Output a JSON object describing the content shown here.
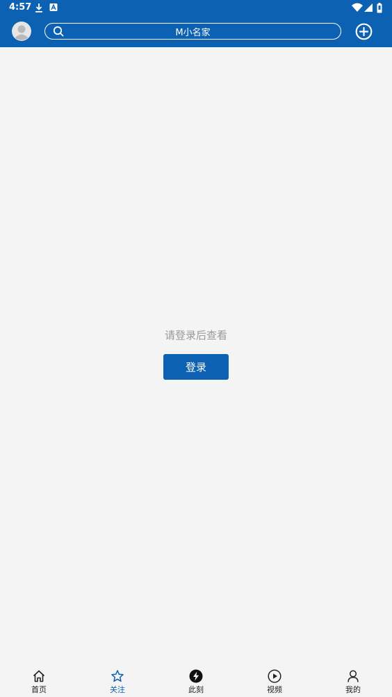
{
  "status_bar": {
    "time": "4:57"
  },
  "header": {
    "search_text": "M小名家"
  },
  "main": {
    "hint": "请登录后查看",
    "login_label": "登录"
  },
  "tabs": [
    {
      "label": "首页",
      "icon": "home-icon",
      "active": false
    },
    {
      "label": "关注",
      "icon": "star-icon",
      "active": true
    },
    {
      "label": "此刻",
      "icon": "lightning-icon",
      "active": false
    },
    {
      "label": "视频",
      "icon": "play-icon",
      "active": false
    },
    {
      "label": "我的",
      "icon": "person-icon",
      "active": false
    }
  ],
  "colors": {
    "brand": "#0d61b2",
    "background": "#f4f4f4",
    "hint": "#999999"
  }
}
